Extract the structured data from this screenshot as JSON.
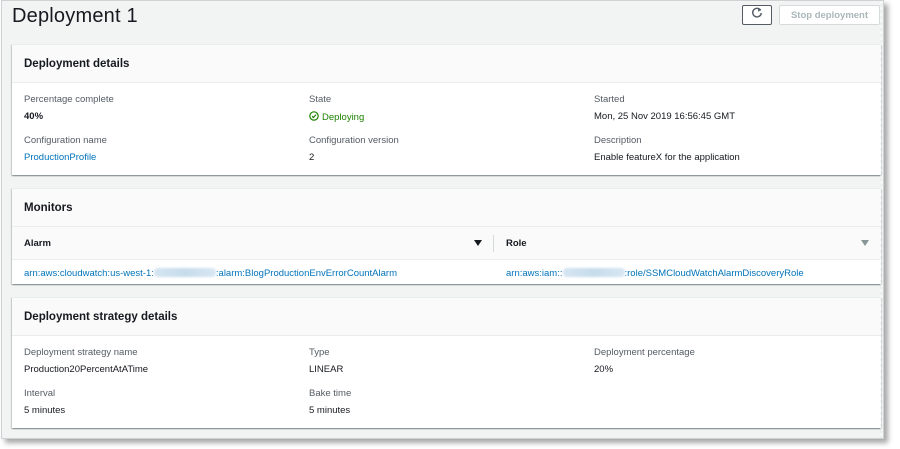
{
  "page": {
    "title": "Deployment 1"
  },
  "toolbar": {
    "refresh_icon": "refresh-icon",
    "stop_label": "Stop deployment"
  },
  "details": {
    "header": "Deployment details",
    "percentage_label": "Percentage complete",
    "percentage_value": "40%",
    "state_label": "State",
    "state_value": "Deploying",
    "started_label": "Started",
    "started_value": "Mon, 25 Nov 2019 16:56:45 GMT",
    "config_name_label": "Configuration name",
    "config_name_value": "ProductionProfile",
    "config_version_label": "Configuration version",
    "config_version_value": "2",
    "description_label": "Description",
    "description_value": "Enable featureX for the application"
  },
  "monitors": {
    "header": "Monitors",
    "columns": [
      "Alarm",
      "Role"
    ],
    "rows": [
      {
        "alarm_prefix": "arn:aws:cloudwatch:us-west-1:",
        "alarm_suffix": ":alarm:BlogProductionEnvErrorCountAlarm",
        "role_prefix": "arn:aws:iam::",
        "role_suffix": ":role/SSMCloudWatchAlarmDiscoveryRole"
      }
    ]
  },
  "strategy": {
    "header": "Deployment strategy details",
    "name_label": "Deployment strategy name",
    "name_value": "Production20PercentAtATime",
    "type_label": "Type",
    "type_value": "LINEAR",
    "percentage_label": "Deployment percentage",
    "percentage_value": "20%",
    "interval_label": "Interval",
    "interval_value": "5 minutes",
    "bake_label": "Bake time",
    "bake_value": "5 minutes"
  },
  "colors": {
    "link": "#0073bb",
    "success": "#1d8102",
    "background": "#f2f3f3"
  }
}
